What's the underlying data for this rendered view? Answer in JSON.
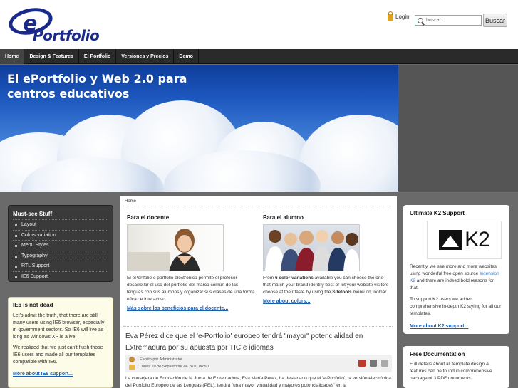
{
  "header": {
    "logo_text": "Portfolio",
    "login_label": "Login",
    "search_placeholder": "buscar...",
    "search_button": "Buscar"
  },
  "nav": {
    "items": [
      "Home",
      "Design & Features",
      "El Portfolio",
      "Versiones y Precios",
      "Demo"
    ]
  },
  "hero": {
    "title": "El ePortfolio y Web 2.0 para centros educativos"
  },
  "mustsee": {
    "title": "Must-see Stuff",
    "items": [
      "Layout",
      "Colors variation",
      "Menu Styles",
      "Typography",
      "RTL Support",
      "IE6 Support"
    ]
  },
  "ie6": {
    "title": "IE6 is not dead",
    "p1": "Let's admit the truth, that there are still many users using IE6 browser, especially in government sectors. So IE6 will live as long as Windows XP is alive.",
    "p2": "We realized that we just can't flush those IE6 users and made all our templates compatible with IE6.",
    "link": "More about IE6 support..."
  },
  "breadcrumb": "Home",
  "docente": {
    "title": "Para el docente",
    "text": "El ePortfolio o portfolio electrónico permite el profesor desarrollar el uso del portfolio del marco común de las lenguas con sus alumnos y organizar sus clases de una forma eficaz e interactivo.",
    "link": "Más sobre los beneficios para el docente..."
  },
  "alumno": {
    "title": "Para el alumno",
    "text_pre": "From ",
    "text_bold": "6 color variations",
    "text_mid": " available you can choose the one that match your brand identity best or let your website visitors choose at their taste by using the ",
    "text_bold2": "Sitetools",
    "text_post": " menu on toolbar.",
    "link": "More about colors..."
  },
  "article": {
    "title": "Eva Pérez dice que el 'e-Portfolio' europeo tendrá \"mayor\" potencialidad en Extremadura por su apuesta por TIC e idiomas",
    "author": "Escrito por Administrator",
    "date": "Lunes 20 de Septiembre de 2010 08:50",
    "body": "La consejera de Educación de la Junta de Extremadura, Eva María Pérez, ha destacado que el 'e-Portfolio', la versión electrónica del Portfolio Europeo de las Lenguas (PEL), tendrá \"una mayor virtualidad y mayores potencialidades\" en la"
  },
  "k2": {
    "title": "Ultimate K2 Support",
    "logo_text": "K2",
    "p1_pre": "Recently, we see more and more websites using wonderful free open source ",
    "p1_link": "extension K2",
    "p1_post": " and there are indeed bold reasons for that.",
    "p2": "To support K2 users we added comprehensive in-depth K2 styling for all our templates.",
    "link": "More about K2 support..."
  },
  "doc": {
    "title": "Free Documentation",
    "text": "Full details about all template design & features can be found in comprehensive package of 3 PDF documents."
  },
  "colors": {
    "brand": "#1a2a8a",
    "link": "#1a5fb0",
    "nav_bg": "#2a2a2a"
  }
}
